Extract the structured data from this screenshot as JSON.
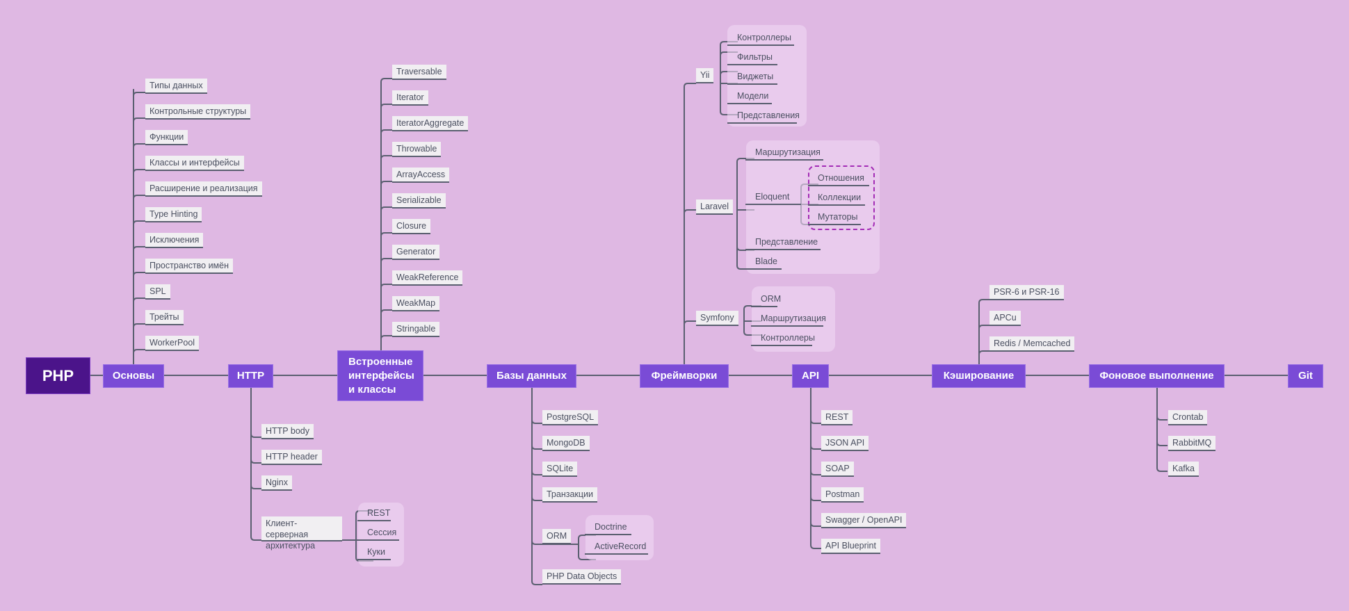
{
  "root": {
    "label": "PHP"
  },
  "colors": {
    "background": "#dfb8e3",
    "root": "#4b148a",
    "main": "#7a4bd6",
    "leaf": "#f1eff2",
    "line": "#5a5f70",
    "dashed": "#a32bb5"
  },
  "branches": {
    "basics": {
      "label": "Основы",
      "items": [
        "Типы данных",
        "Контрольные структуры",
        "Функции",
        "Классы и интерфейсы",
        "Расширение и реализация",
        "Type Hinting",
        "Исключения",
        "Пространство имён",
        "SPL",
        "Трейты",
        "WorkerPool"
      ]
    },
    "http": {
      "label": "HTTP",
      "items": [
        "HTTP body",
        "HTTP header",
        "Nginx"
      ],
      "client_server": {
        "label": "Клиент-серверная архитектура",
        "children": [
          "REST",
          "Сессия",
          "Куки"
        ]
      }
    },
    "builtin": {
      "label": "Встроенные интерфейсы и классы",
      "items": [
        "Traversable",
        "Iterator",
        "IteratorAggregate",
        "Throwable",
        "ArrayAccess",
        "Serializable",
        "Closure",
        "Generator",
        "WeakReference",
        "WeakMap",
        "Stringable"
      ]
    },
    "databases": {
      "label": "Базы данных",
      "items": [
        "PostgreSQL",
        "MongoDB",
        "SQLite",
        "Транзакции"
      ],
      "orm": {
        "label": "ORM",
        "children": [
          "Doctrine",
          "ActiveRecord"
        ]
      },
      "last": "PHP Data Objects"
    },
    "frameworks": {
      "label": "Фреймворки",
      "yii": {
        "label": "Yii",
        "children": [
          "Контроллеры",
          "Фильтры",
          "Виджеты",
          "Модели",
          "Представления"
        ]
      },
      "laravel": {
        "label": "Laravel",
        "routing": "Маршрутизация",
        "eloquent": {
          "label": "Eloquent",
          "children": [
            "Отношения",
            "Коллекции",
            "Мутаторы"
          ]
        },
        "view": "Представление",
        "blade": "Blade"
      },
      "symfony": {
        "label": "Symfony",
        "children": [
          "ORM",
          "Маршрутизация",
          "Контроллеры"
        ]
      }
    },
    "api": {
      "label": "API",
      "items": [
        "REST",
        "JSON API",
        "SOAP",
        "Postman",
        "Swagger / OpenAPI",
        "API Blueprint"
      ]
    },
    "caching": {
      "label": "Кэширование",
      "items": [
        "PSR-6 и PSR-16",
        "APCu",
        "Redis / Memcached"
      ]
    },
    "background": {
      "label": "Фоновое выполнение",
      "items": [
        "Crontab",
        "RabbitMQ",
        "Kafka"
      ]
    },
    "git": {
      "label": "Git"
    }
  }
}
